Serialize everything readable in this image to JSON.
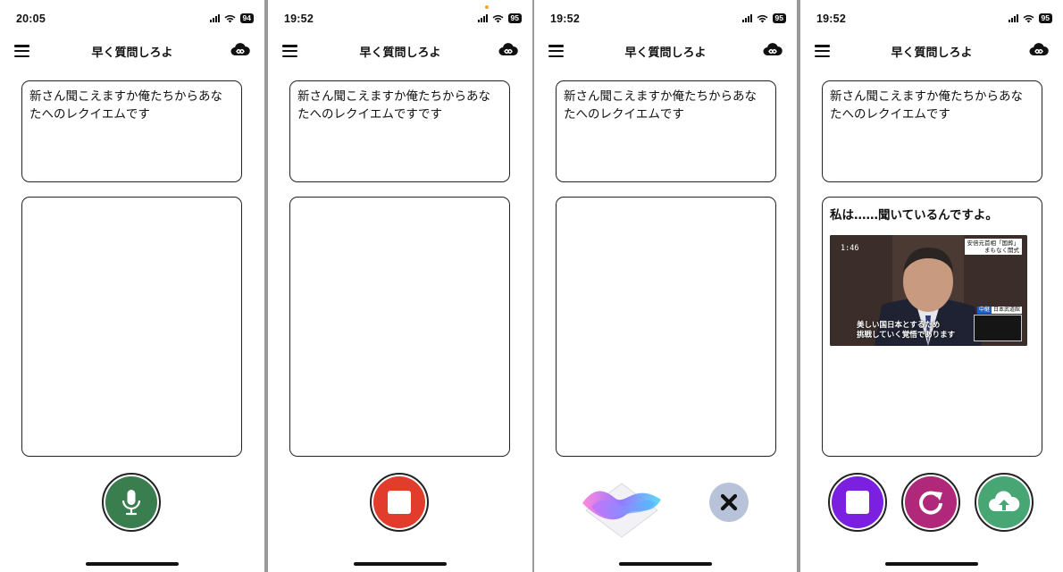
{
  "app": {
    "title": "早く質問しろよ"
  },
  "query_text": "新さん聞こえますか俺たちからあなたへのレクイエムです",
  "screens": [
    {
      "time": "20:05",
      "battery": "94",
      "query": "新さん聞こえますか俺たちからあなたへのレクイエムです",
      "answer": "",
      "buttons": [
        {
          "icon": "mic-icon",
          "color": "#3a7d4f"
        }
      ]
    },
    {
      "time": "19:52",
      "battery": "95",
      "query": "新さん聞こえますか俺たちからあなたへのレクイエムですです",
      "answer": "",
      "buttons": [
        {
          "icon": "stop-icon",
          "color": "#e23c2c"
        }
      ]
    },
    {
      "time": "19:52",
      "battery": "95",
      "query": "新さん聞こえますか俺たちからあなたへのレクイエムです",
      "answer": "",
      "buttons": [
        {
          "icon": "siri-icon"
        },
        {
          "icon": "close-icon",
          "color": "#b8c3d9"
        }
      ]
    },
    {
      "time": "19:52",
      "battery": "95",
      "query": "新さん聞こえますか俺たちからあなたへのレクイエムです",
      "answer": "私は……聞いているんですよ。",
      "image": {
        "timestamp": "1:46",
        "caption_top_line1": "安倍元首相「国葬」",
        "caption_top_line2": "まもなく開式",
        "badge_live": "中継",
        "badge_venue": "日本武道館",
        "subtitle_line1": "美しい国日本とするため",
        "subtitle_line2": "挑戦していく覚悟であります"
      },
      "buttons": [
        {
          "icon": "stop-icon",
          "color": "#7b1fe0"
        },
        {
          "icon": "redo-icon",
          "color": "#b0287a"
        },
        {
          "icon": "cloud-upload-icon",
          "color": "#48a574"
        }
      ]
    }
  ]
}
